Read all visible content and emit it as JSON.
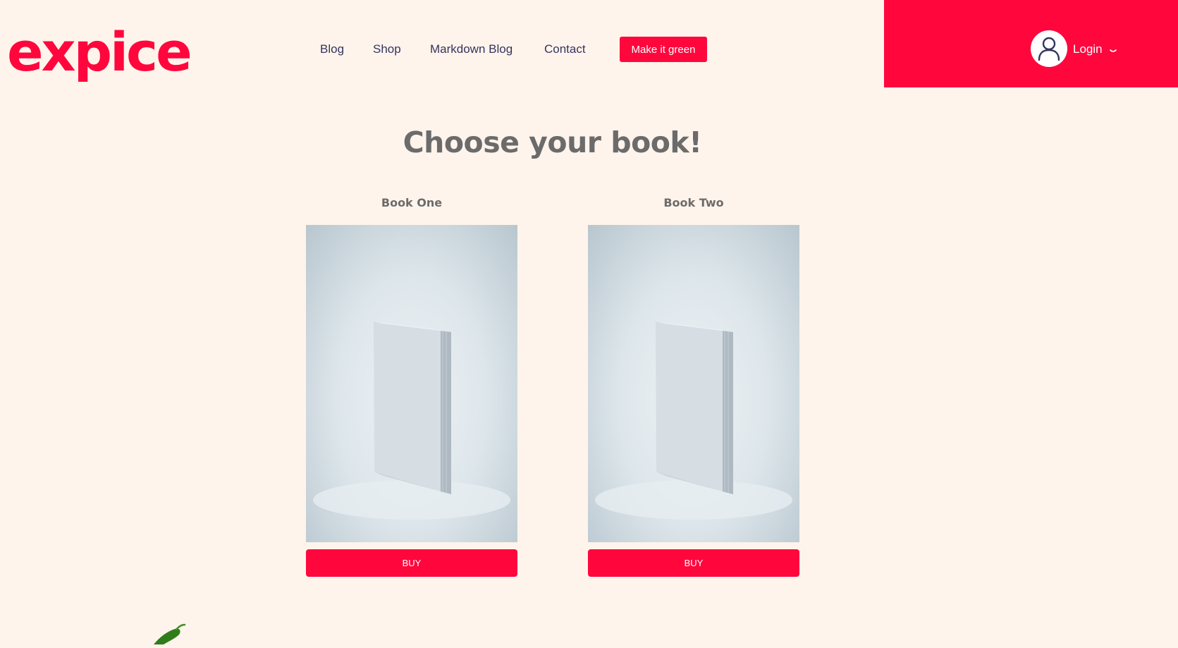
{
  "brand": {
    "logo": "expice"
  },
  "nav": {
    "links": [
      {
        "label": "Blog"
      },
      {
        "label": "Shop"
      },
      {
        "label": "Markdown Blog"
      },
      {
        "label": "Contact"
      }
    ],
    "cta_label": "Make it green"
  },
  "user": {
    "login_label": "Login",
    "icon": "user-icon"
  },
  "main": {
    "title": "Choose your book!",
    "books": [
      {
        "title": "Book One",
        "buy_label": "BUY"
      },
      {
        "title": "Book Two",
        "buy_label": "BUY"
      }
    ]
  },
  "colors": {
    "accent": "#ff073d",
    "background": "#fff4ec",
    "nav_text": "#34345e",
    "heading": "#6b6b6b"
  }
}
